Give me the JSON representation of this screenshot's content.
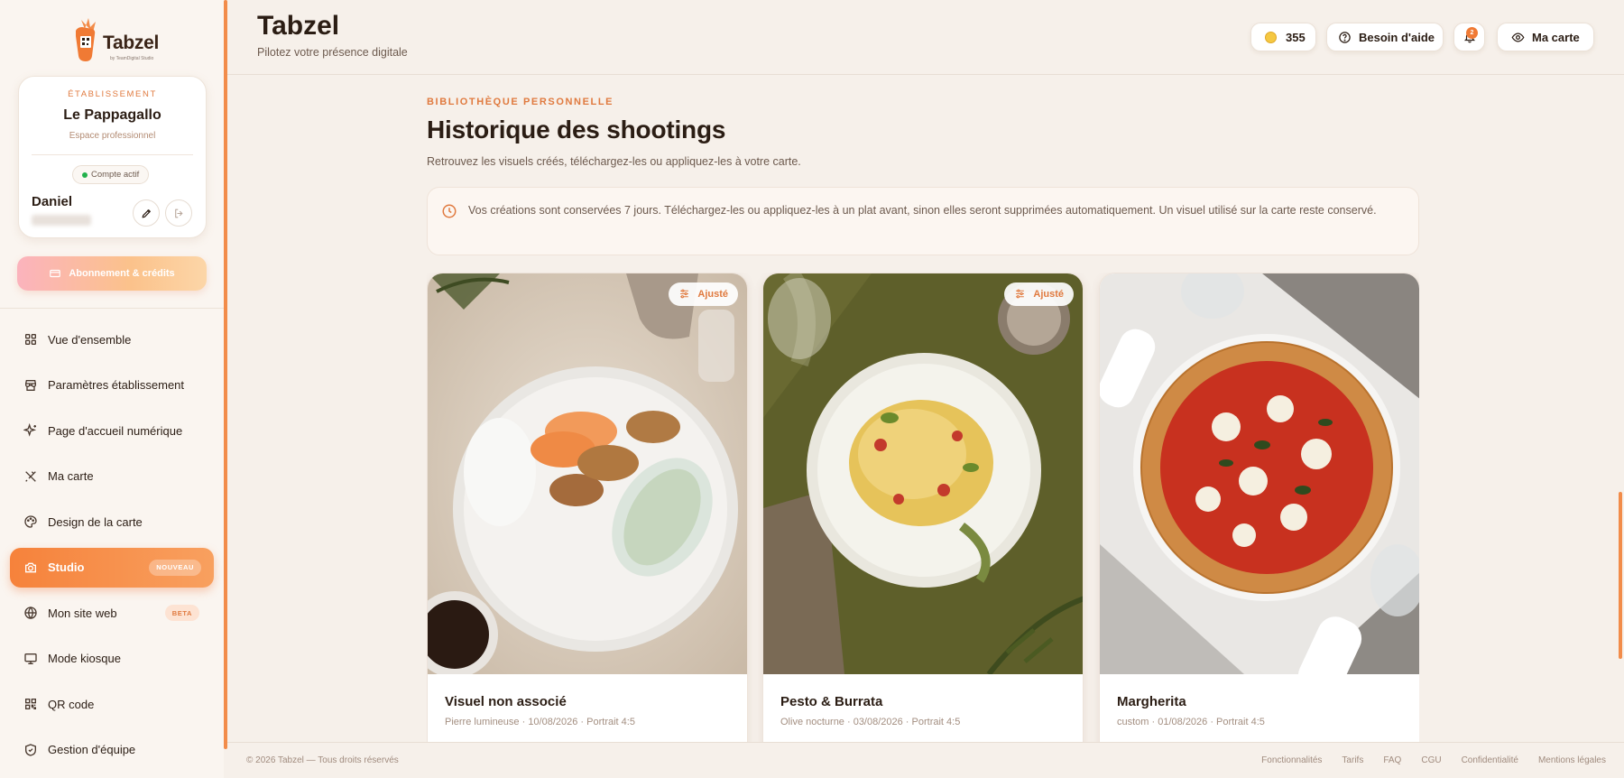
{
  "brand": {
    "name": "Tabzel",
    "tagline": "Pilotez votre présence digitale",
    "logo_sub": "by TeamDigital Studio"
  },
  "establishment": {
    "label": "ÉTABLISSEMENT",
    "name": "Le Pappagallo",
    "space": "Espace professionnel",
    "status": "Compte actif"
  },
  "user": {
    "name": "Daniel"
  },
  "subscription_button": "Abonnement & crédits",
  "nav": [
    {
      "label": "Vue d'ensemble",
      "icon": "grid-icon"
    },
    {
      "label": "Paramètres établissement",
      "icon": "store-icon"
    },
    {
      "label": "Page d'accueil numérique",
      "icon": "sparkle-icon"
    },
    {
      "label": "Ma carte",
      "icon": "utensils-icon"
    },
    {
      "label": "Design de la carte",
      "icon": "palette-icon"
    },
    {
      "label": "Studio",
      "icon": "camera-icon",
      "badge": "NOUVEAU",
      "active": true
    },
    {
      "label": "Mon site web",
      "icon": "globe-icon",
      "badge": "BETA"
    },
    {
      "label": "Mode kiosque",
      "icon": "monitor-icon"
    },
    {
      "label": "QR code",
      "icon": "qr-icon"
    },
    {
      "label": "Gestion d'équipe",
      "icon": "shield-icon"
    }
  ],
  "header": {
    "credits": "355",
    "help": "Besoin d'aide",
    "notifications": "2",
    "my_menu": "Ma carte"
  },
  "page": {
    "eyebrow": "BIBLIOTHÈQUE PERSONNELLE",
    "title": "Historique des shootings",
    "description": "Retrouvez les visuels créés, téléchargez-les ou appliquez-les à votre carte.",
    "notice": "Vos créations sont conservées 7 jours. Téléchargez-les ou appliquez-les à un plat avant, sinon elles seront supprimées automatiquement. Un visuel utilisé sur la carte reste conservé."
  },
  "shootings": [
    {
      "title": "Visuel non associé",
      "meta": "Pierre lumineuse · 10/08/2026 · Portrait 4:5",
      "badge": "Ajusté"
    },
    {
      "title": "Pesto & Burrata",
      "meta": "Olive nocturne · 03/08/2026 · Portrait 4:5",
      "badge": "Ajusté"
    },
    {
      "title": "Margherita",
      "meta": "custom · 01/08/2026 · Portrait 4:5",
      "badge": ""
    }
  ],
  "footer": {
    "copyright": "© 2026 Tabzel — Tous droits réservés",
    "links": [
      "Fonctionnalités",
      "Tarifs",
      "FAQ",
      "CGU",
      "Confidentialité",
      "Mentions légales"
    ]
  },
  "colors": {
    "accent": "#f28c4a",
    "accent_text": "#e07a3f",
    "background": "#f6f0ea",
    "text": "#2b1d14"
  }
}
